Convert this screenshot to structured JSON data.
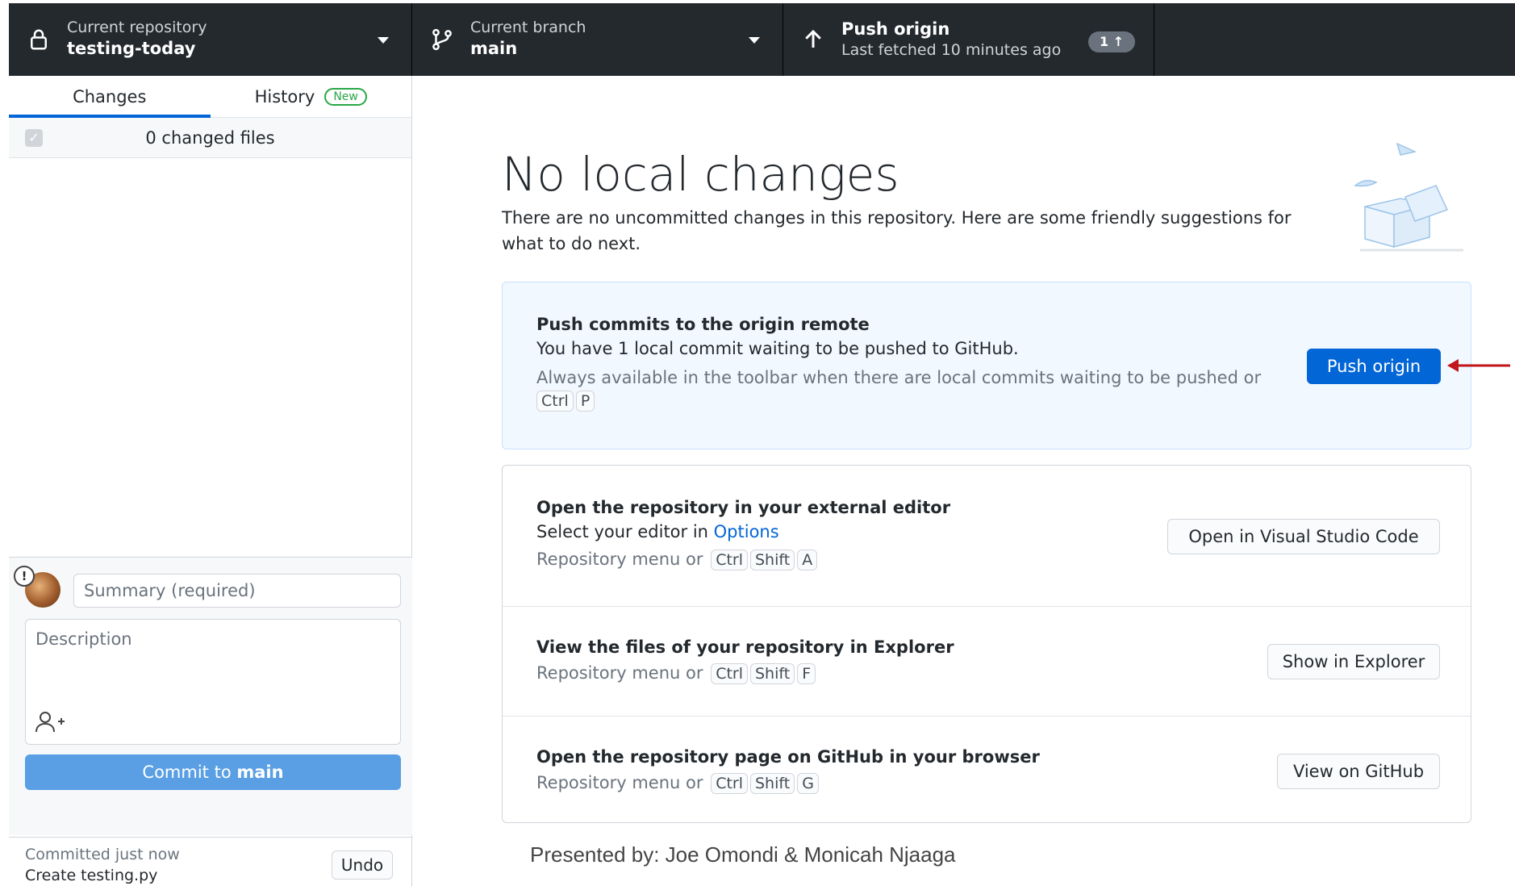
{
  "toolbar": {
    "repository": {
      "label": "Current repository",
      "value": "testing-today"
    },
    "branch": {
      "label": "Current branch",
      "value": "main"
    },
    "push": {
      "label": "Push origin",
      "sub": "Last fetched 10 minutes ago",
      "badge": "1 ↑"
    }
  },
  "sidebar": {
    "tabs": [
      {
        "label": "Changes",
        "active": true
      },
      {
        "label": "History",
        "badge": "New"
      }
    ],
    "files_count": "0 changed files",
    "commit": {
      "summary_placeholder": "Summary (required)",
      "description_placeholder": "Description",
      "button_prefix": "Commit to ",
      "button_branch": "main"
    },
    "last_commit": {
      "time": "Committed just now",
      "title": "Create testing.py",
      "undo": "Undo"
    }
  },
  "main": {
    "heading": "No local changes",
    "subtitle": "There are no uncommitted changes in this repository. Here are some friendly suggestions for what to do next.",
    "push_card": {
      "title": "Push commits to the origin remote",
      "desc": "You have 1 local commit waiting to be pushed to GitHub.",
      "hint": "Always available in the toolbar when there are local commits waiting to be pushed or",
      "keys": [
        "Ctrl",
        "P"
      ],
      "button": "Push origin"
    },
    "editor_card": {
      "title": "Open the repository in your external editor",
      "desc_prefix": "Select your editor in ",
      "desc_link": "Options",
      "hint": "Repository menu or",
      "keys": [
        "Ctrl",
        "Shift",
        "A"
      ],
      "button": "Open in Visual Studio Code"
    },
    "explorer_card": {
      "title": "View the files of your repository in Explorer",
      "hint": "Repository menu or",
      "keys": [
        "Ctrl",
        "Shift",
        "F"
      ],
      "button": "Show in Explorer"
    },
    "github_card": {
      "title": "Open the repository page on GitHub in your browser",
      "hint": "Repository menu or",
      "keys": [
        "Ctrl",
        "Shift",
        "G"
      ],
      "button": "View on GitHub"
    },
    "presenter": "Presented by: Joe Omondi & Monicah Njaaga"
  },
  "colors": {
    "toolbar_bg": "#24292e",
    "primary": "#0366d6",
    "annotation_arrow": "#c0161c"
  }
}
